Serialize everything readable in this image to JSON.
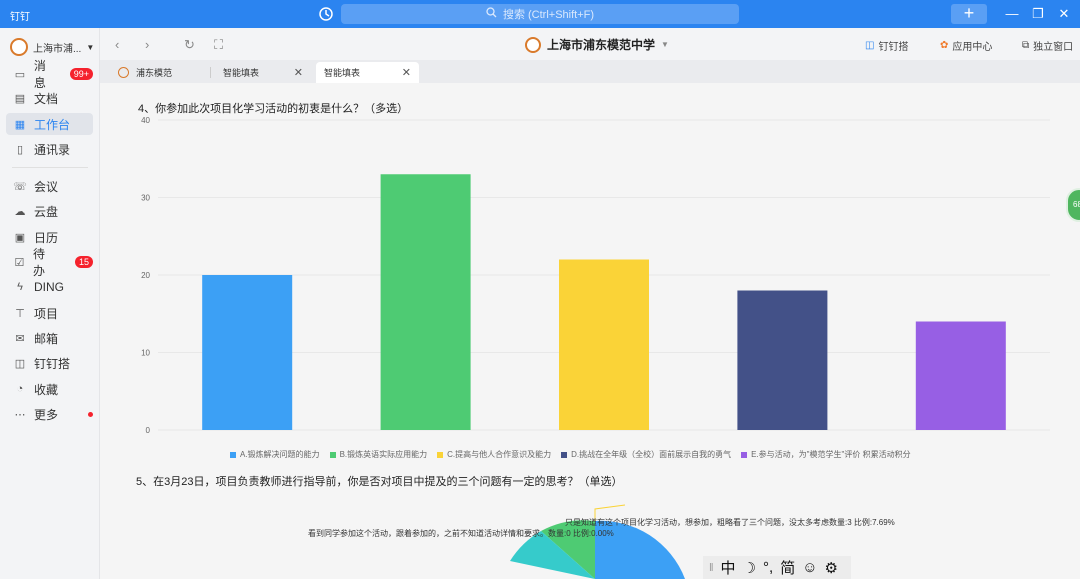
{
  "titlebar": {
    "app_name": "钉钉",
    "search_placeholder": "搜索 (Ctrl+Shift+F)",
    "plus": "+",
    "minimize": "—",
    "restore": "❐",
    "close": "✕"
  },
  "sidebar": {
    "org_name": "上海市浦...",
    "items": [
      {
        "label": "消息",
        "badge": "99+"
      },
      {
        "label": "文档"
      },
      {
        "label": "工作台"
      },
      {
        "label": "通讯录"
      },
      {
        "label": "会议"
      },
      {
        "label": "云盘"
      },
      {
        "label": "日历"
      },
      {
        "label": "待办",
        "badge": "15"
      },
      {
        "label": "DING"
      },
      {
        "label": "项目"
      },
      {
        "label": "邮箱"
      },
      {
        "label": "钉钉搭"
      },
      {
        "label": "收藏"
      },
      {
        "label": "更多"
      }
    ]
  },
  "toolbar": {
    "site_title": "上海市浦东模范中学",
    "dingdingda": "钉钉搭",
    "app_center": "应用中心",
    "standalone": "独立窗口"
  },
  "tabs": [
    {
      "label": "浦东模范"
    },
    {
      "label": "智能填表"
    },
    {
      "label": "智能填表"
    }
  ],
  "question4": {
    "title": "4、你参加此次项目化学习活动的初衷是什么？（多选）"
  },
  "question5": {
    "title": "5、在3月23日，项目负责教师进行指导前，你是否对项目中提及的三个问题有一定的思考？（单选）",
    "labels": [
      "只是知道有这个项目化学习活动，想参加，粗略看了三个问题，没太多考虑数量:3 比例:7.69%",
      "看到同学参加这个活动，跟着参加的，之前不知道活动详情和要求。数量:0 比例:0.00%"
    ]
  },
  "chart_data": {
    "type": "bar",
    "categories": [
      "A.锻炼解决问题的能力",
      "B.锻炼英语实际应用能力",
      "C.提高与他人合作意识及能力",
      "D.挑战在全年级（全校）面前展示自我的勇气",
      "E.参与活动，为\"模范学生\"评价 积累活动积分"
    ],
    "values": [
      20,
      33,
      22,
      18,
      14
    ],
    "colors": [
      "#3ca0f5",
      "#4ecb73",
      "#fad337",
      "#435188",
      "#975fe4"
    ],
    "yticks": [
      "0",
      "10",
      "20",
      "30",
      "40"
    ],
    "ylim": [
      0,
      40
    ],
    "grid": true,
    "legend": "bottom"
  },
  "ime": {
    "lang": "中",
    "moon": "☽",
    "punct": "°,",
    "simp": "简",
    "emoji": "☺",
    "settings": "⚙"
  },
  "float_badge": "68"
}
